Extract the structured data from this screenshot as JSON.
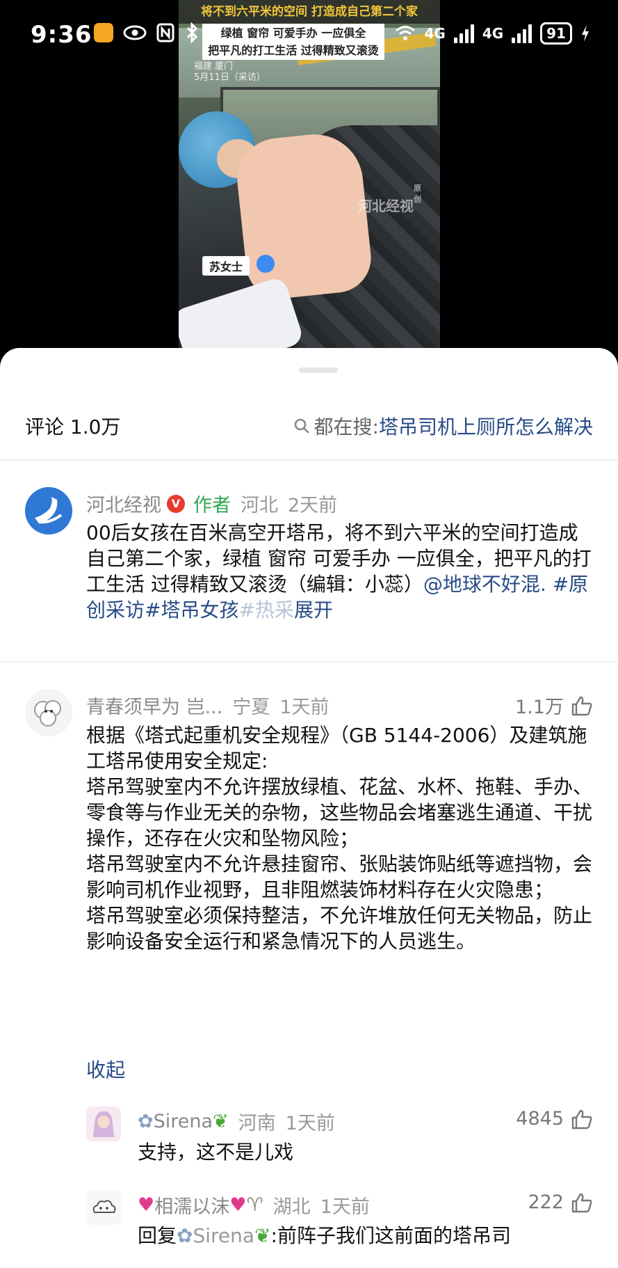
{
  "status_bar": {
    "time": "9:36",
    "network_1": "4G",
    "network_2": "4G",
    "battery": "91"
  },
  "video": {
    "title": "将不到六平米的空间 打造成自己第二个家",
    "subtitle_line1": "绿植 窗帘 可爱手办 一应俱全",
    "subtitle_line2": "把平凡的打工生活 过得精致又滚烫",
    "location": "福建 厦门",
    "date": "5月11日（采访）",
    "watermark": "河北经视",
    "watermark_tag": "原创",
    "speaker": "苏女士"
  },
  "header": {
    "comments_label": "评论 1.0万",
    "search_prefix": "都在搜:",
    "search_query": "塔吊司机上厕所怎么解决"
  },
  "author_post": {
    "name": "河北经视",
    "verified": "V",
    "author_tag": "作者",
    "region": "河北",
    "time": "2天前",
    "text_main": "00后女孩在百米高空开塔吊，将不到六平米的空间打造成自己第二个家，绿植 窗帘 可爱手办 一应俱全，把平凡的打工生活 过得精致又滚烫（编辑：小蕊）",
    "mention": "@地球不好混.",
    "tag1": "#原创采访",
    "tag2": "#塔吊女孩",
    "tag3_partial": "#热采",
    "expand": "展开"
  },
  "comment1": {
    "name": "青春须早为 岂...",
    "region": "宁夏",
    "time": "1天前",
    "likes": "1.1万",
    "text": "根据《塔式起重机安全规程》（GB 5144-2006）及建筑施工塔吊使用安全规定:\n塔吊驾驶室内不允许摆放绿植、花盆、水杯、拖鞋、手办、零食等与作业无关的杂物，这些物品会堵塞逃生通道、干扰操作，还存在火灾和坠物风险；\n塔吊驾驶室内不允许悬挂窗帘、张贴装饰贴纸等遮挡物，会影响司机作业视野，且非阻燃装饰材料存在火灾隐患；\n塔吊驾驶室必须保持整洁，不允许堆放任何无关物品，防止影响设备安全运行和紧急情况下的人员逃生。",
    "collapse": "收起"
  },
  "reply1": {
    "name": "Sirena",
    "region": "河南",
    "time": "1天前",
    "likes": "4845",
    "text": "支持，这不是儿戏"
  },
  "reply2": {
    "name": "相濡以沫",
    "region": "湖北",
    "time": "1天前",
    "likes": "222",
    "reply_prefix": "回复",
    "reply_to": "Sirena",
    "text": ":前阵子我们这前面的塔吊司"
  },
  "colors": {
    "link_blue": "#274b86",
    "author_green": "#2fa84f",
    "verified_red": "#e63b2e",
    "meta_gray": "#999999"
  },
  "icons": [
    "search-icon",
    "thumbs-up-icon",
    "verified-icon",
    "wifi-icon",
    "signal-icon",
    "battery-icon",
    "eye-icon",
    "nfc-icon",
    "bluetooth-icon",
    "microphone-icon"
  ]
}
